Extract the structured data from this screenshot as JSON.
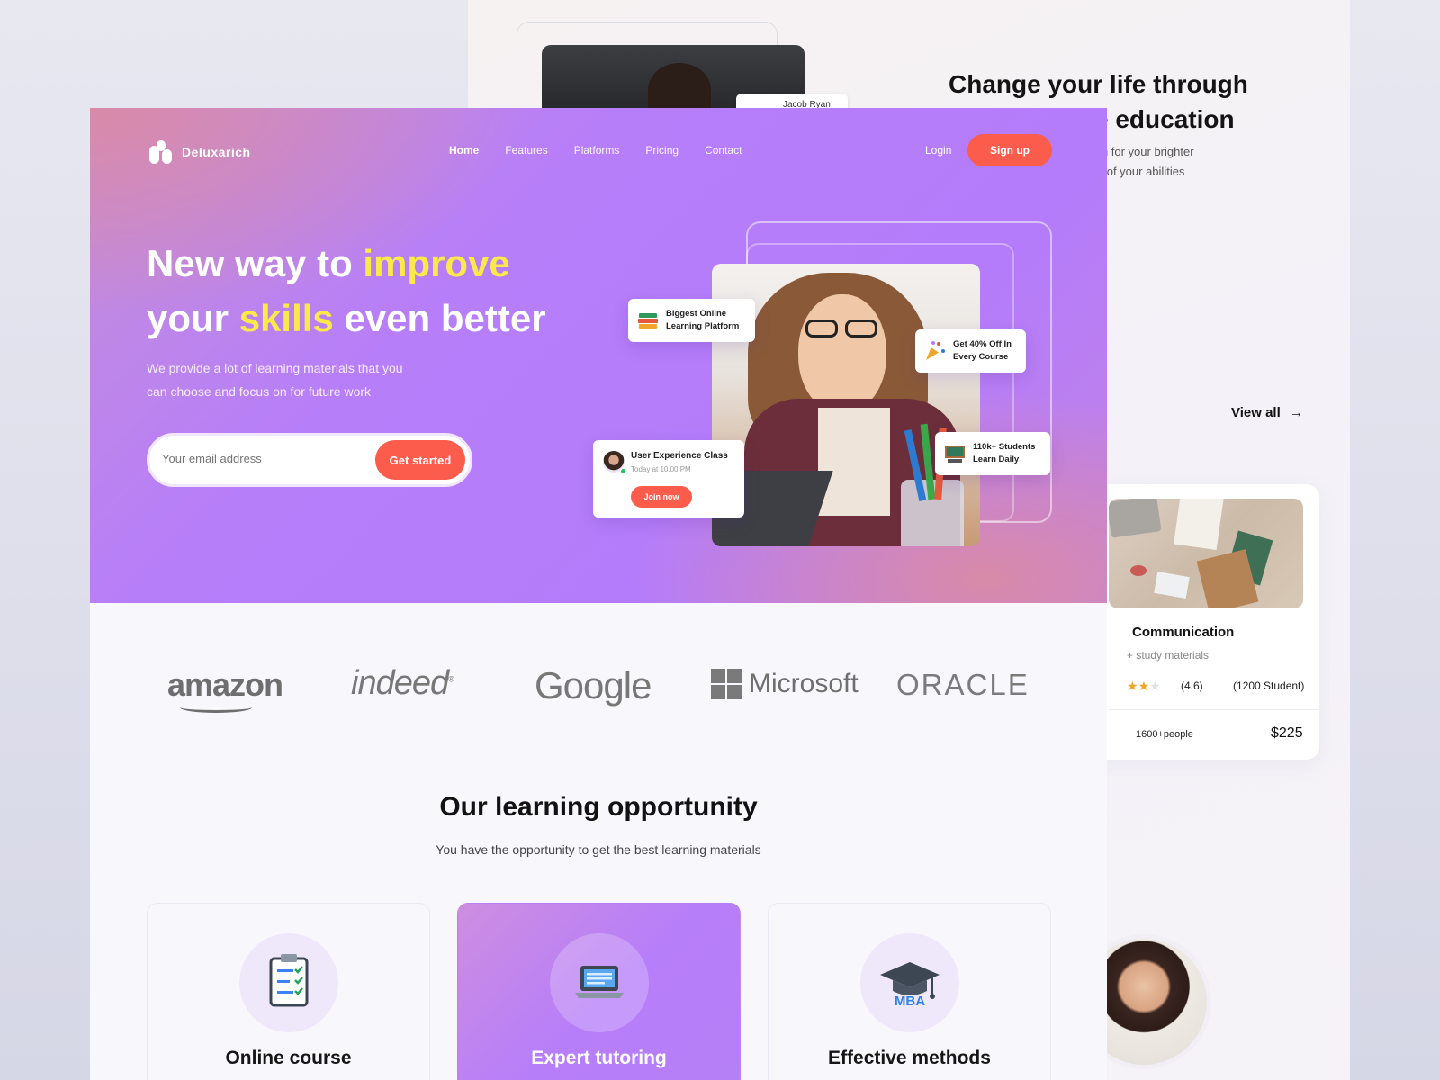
{
  "back": {
    "chip_text": "Jacob Ryan",
    "heading_line1": "Change your life through",
    "heading_line2": "e education",
    "sub_line1": "rm for your brighter",
    "sub_line2": "ty of your abilities",
    "view_all": "View all",
    "view_all_icon": "arrow-right-icon",
    "course_card": {
      "title": "Communication",
      "subtitle": "+ study materials",
      "rating": "(4.6)",
      "rating_value": 4.6,
      "students": "(1200 Student)",
      "people": "1600+people",
      "price": "$225"
    }
  },
  "brand": {
    "name": "Deluxarich"
  },
  "nav": {
    "items": [
      "Home",
      "Features",
      "Platforms",
      "Pricing",
      "Contact"
    ],
    "active": "Home",
    "login": "Login",
    "signup": "Sign up"
  },
  "hero": {
    "title_a": "New way to ",
    "title_b": "improve",
    "title_c": "your ",
    "title_d": "skills",
    "title_e": " even better",
    "description_line1": "We provide a lot of learning materials that you",
    "description_line2": "can choose and focus on for future work",
    "email_placeholder": "Your email address",
    "cta": "Get started",
    "chips": {
      "platform_line1": "Biggest Online",
      "platform_line2": "Learning Platform",
      "discount_line1": "Get 40% Off In",
      "discount_line2": "Every Course",
      "students_line1": "110k+ Students",
      "students_line2": "Learn Daily"
    },
    "class_card": {
      "title": "User Experience Class",
      "time": "Today at 10.00 PM",
      "join": "Join now"
    }
  },
  "partners": [
    "amazon",
    "indeed",
    "Google",
    "Microsoft",
    "ORACLE"
  ],
  "learning": {
    "title": "Our learning opportunity",
    "subtitle": "You have the opportunity to get the best learning materials",
    "features": [
      {
        "label": "Online course",
        "icon": "clipboard-checklist-icon"
      },
      {
        "label": "Expert tutoring",
        "icon": "laptop-icon"
      },
      {
        "label": "Effective methods",
        "icon": "graduation-cap-icon",
        "badge": "MBA"
      }
    ]
  },
  "colors": {
    "accent": "#fb5c4b",
    "hero_purple": "#b77ef9",
    "highlight": "#fbe94a"
  }
}
